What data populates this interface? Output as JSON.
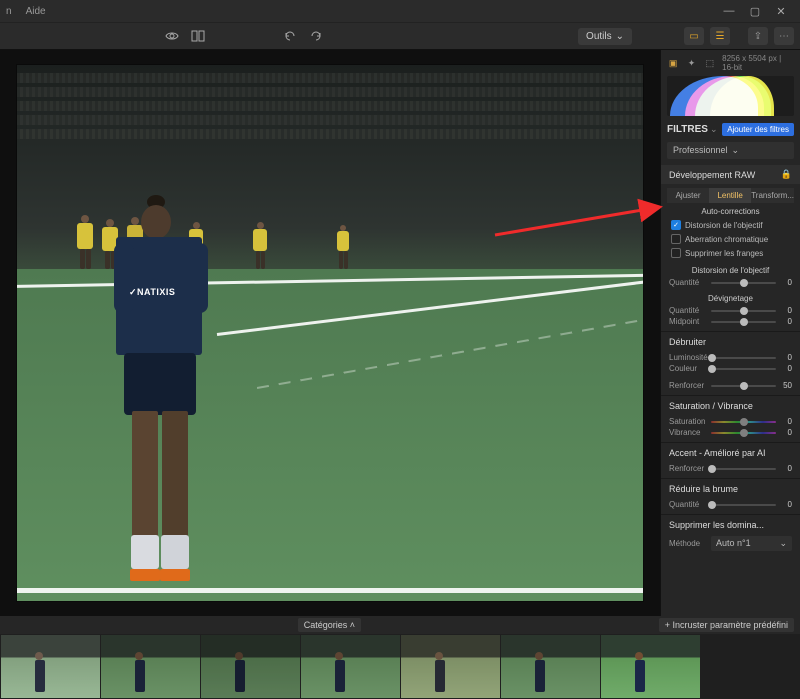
{
  "titlebar": {
    "help_label": "Aide"
  },
  "toolbar": {
    "tools_label": "Outils"
  },
  "sidepanel": {
    "image_info": "8256 x 5504 px | 16-bit",
    "filters_title": "FILTRES",
    "add_filters_label": "Ajouter des filtres",
    "profile_label": "Professionnel",
    "raw_dev_label": "Développement RAW",
    "tabs": {
      "adjust": "Ajuster",
      "lens": "Lentille",
      "transform": "Transform..."
    },
    "auto_corrections_title": "Auto-corrections",
    "checks": {
      "lens_distortion": "Distorsion de l'objectif",
      "chromatic_aberration": "Aberration chromatique",
      "remove_fringes": "Supprimer les franges"
    },
    "lens_sect": "Distorsion de l'objectif",
    "sliders": {
      "quantity": "Quantité",
      "midpoint": "Midpoint",
      "luminosity": "Luminosité",
      "color": "Couleur",
      "enhance": "Renforcer",
      "saturation": "Saturation",
      "vibrance": "Vibrance",
      "method": "Méthode"
    },
    "vignette_title": "Dévignetage",
    "denoise_title": "Débruiter",
    "sat_vib_title": "Saturation / Vibrance",
    "accent_title": "Accent - Amélioré par AI",
    "dehaze_title": "Réduire la brume",
    "remove_dominant_title": "Supprimer les domina...",
    "method_value": "Auto n°1",
    "values": {
      "zero": "0",
      "fifty": "50"
    }
  },
  "bottombar": {
    "categories_label": "Catégories",
    "preset_label": "+ Incruster paramètre prédéfini"
  },
  "photo": {
    "shirt_brand": "✓NATIXIS"
  }
}
